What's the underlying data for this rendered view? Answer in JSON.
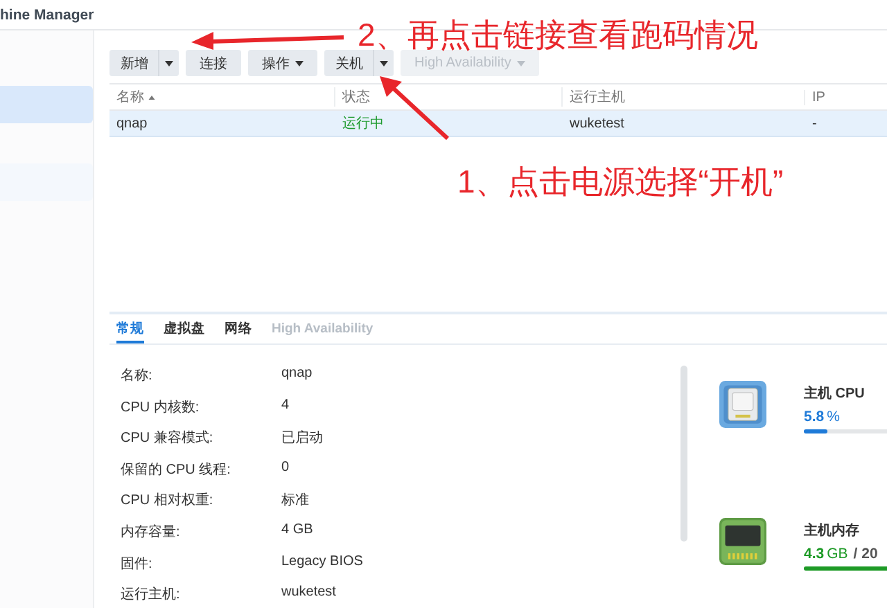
{
  "window": {
    "title": "hine Manager"
  },
  "sidebar": {
    "items": [
      {
        "selected": true
      },
      {
        "selected": false
      }
    ]
  },
  "toolbar": [
    {
      "kind": "split",
      "label": "新增",
      "disabled": false
    },
    {
      "kind": "plain",
      "label": "连接",
      "disabled": false
    },
    {
      "kind": "menu",
      "label": "操作",
      "disabled": false
    },
    {
      "kind": "split",
      "label": "关机",
      "disabled": false
    },
    {
      "kind": "menu",
      "label": "High Availability",
      "disabled": true
    }
  ],
  "table": {
    "columns": [
      {
        "label": "名称",
        "sorted": true
      },
      {
        "label": "状态",
        "sorted": false
      },
      {
        "label": "运行主机",
        "sorted": false
      },
      {
        "label": "IP",
        "sorted": false
      }
    ],
    "rows": [
      {
        "selected": true,
        "cells": [
          {
            "text": "qnap",
            "kind": "plain"
          },
          {
            "text": "运行中",
            "kind": "running"
          },
          {
            "text": "wuketest",
            "kind": "plain"
          },
          {
            "text": "-",
            "kind": "plain"
          }
        ]
      }
    ]
  },
  "detail": {
    "tabs": [
      {
        "label": "常规",
        "selected": true,
        "disabled": false
      },
      {
        "label": "虚拟盘",
        "selected": false,
        "disabled": false
      },
      {
        "label": "网络",
        "selected": false,
        "disabled": false
      },
      {
        "label": "High Availability",
        "selected": false,
        "disabled": true
      }
    ],
    "fields": [
      {
        "label": "名称:",
        "value": "qnap"
      },
      {
        "label": "CPU 内核数:",
        "value": "4"
      },
      {
        "label": "CPU 兼容模式:",
        "value": "已启动"
      },
      {
        "label": "保留的 CPU 线程:",
        "value": "0"
      },
      {
        "label": "CPU 相对权重:",
        "value": "标准"
      },
      {
        "label": "内存容量:",
        "value": "4 GB"
      },
      {
        "label": "固件:",
        "value": "Legacy BIOS"
      },
      {
        "label": "运行主机:",
        "value": "wuketest"
      }
    ],
    "resources": [
      {
        "kind": "cpu",
        "title": "主机 CPU",
        "value": "5.8",
        "unit": "%",
        "level": 0.058
      },
      {
        "kind": "memory",
        "title": "主机内存",
        "value": "4.3",
        "unit": "GB",
        "total": "/ 20",
        "level": 0.215
      }
    ]
  },
  "annotations": [
    {
      "kind": "top",
      "text": "2、再点击链接查看跑码情况"
    },
    {
      "kind": "bottom",
      "text": "1、点击电源选择“开机”"
    }
  ]
}
